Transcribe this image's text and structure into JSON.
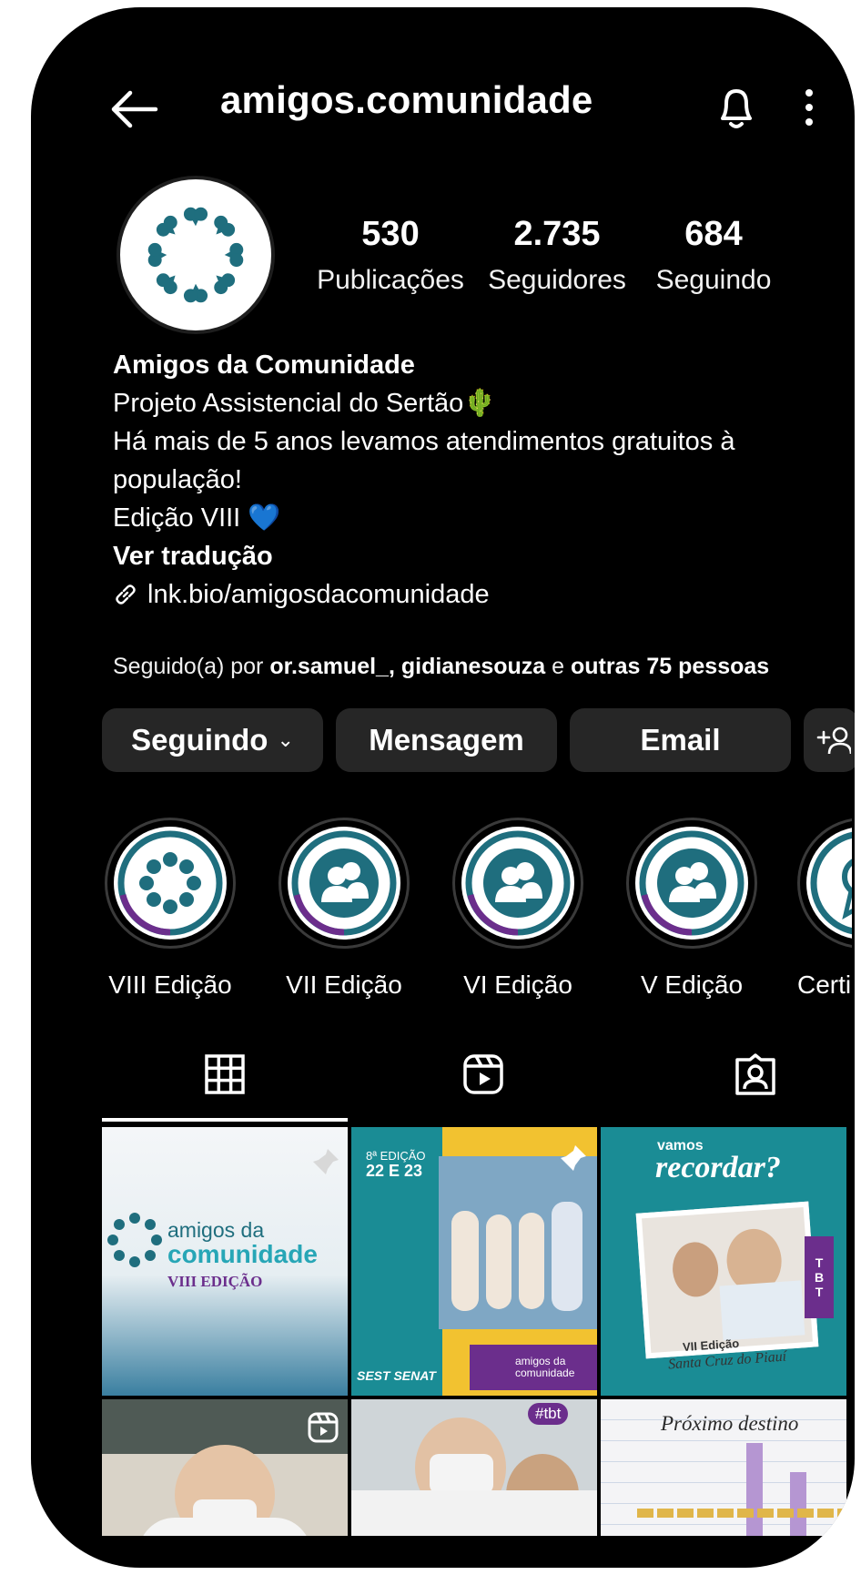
{
  "header": {
    "username": "amigos.comunidade"
  },
  "stats": [
    {
      "value": "530",
      "label": "Publicações"
    },
    {
      "value": "2.735",
      "label": "Seguidores"
    },
    {
      "value": "684",
      "label": "Seguindo"
    }
  ],
  "bio": {
    "name": "Amigos da Comunidade",
    "line1": "Projeto Assistencial do Sertão🌵",
    "line2": "Há mais de 5 anos levamos atendimentos gratuitos à população!",
    "line3": "Edição VIII 💙",
    "translate": "Ver tradução",
    "link": "lnk.bio/amigosdacomunidade"
  },
  "followed_by": {
    "prefix": "Seguido(a) por ",
    "names": "or.samuel_, gidianesouza",
    "conj": " e ",
    "others": "outras 75 pessoas"
  },
  "buttons": {
    "following": "Seguindo",
    "message": "Mensagem",
    "email": "Email",
    "add_user_icon": "add-user-icon"
  },
  "highlights": [
    {
      "label": "VIII Edição",
      "icon": "logo-icon"
    },
    {
      "label": "VII Edição",
      "icon": "people-icon"
    },
    {
      "label": "VI Edição",
      "icon": "people-icon"
    },
    {
      "label": "V Edição",
      "icon": "people-icon"
    },
    {
      "label": "Certi",
      "icon": "certificate-icon"
    }
  ],
  "tabs": [
    "grid-icon",
    "reels-icon",
    "tagged-icon"
  ],
  "posts": {
    "p1": {
      "line1": "amigos da",
      "line2": "comunidade",
      "line3": "VIII EDIÇÃO"
    },
    "p2": {
      "edition": "8ª EDIÇÃO",
      "date": "22 E 23",
      "sponsor": "SEST SENAT",
      "brand": "amigos da comunidade"
    },
    "p3": {
      "line1": "vamos",
      "line2": "recordar?",
      "edition": "VII Edição",
      "city": "Santa Cruz do Piauí",
      "tag": "TBT"
    },
    "p5": {
      "tag": "#tbt"
    },
    "p6": {
      "title": "Próximo destino"
    }
  },
  "colors": {
    "background": "#000000",
    "button": "#262626",
    "brand_teal": "#1f6e7e",
    "brand_purple": "#6b2e8c"
  }
}
